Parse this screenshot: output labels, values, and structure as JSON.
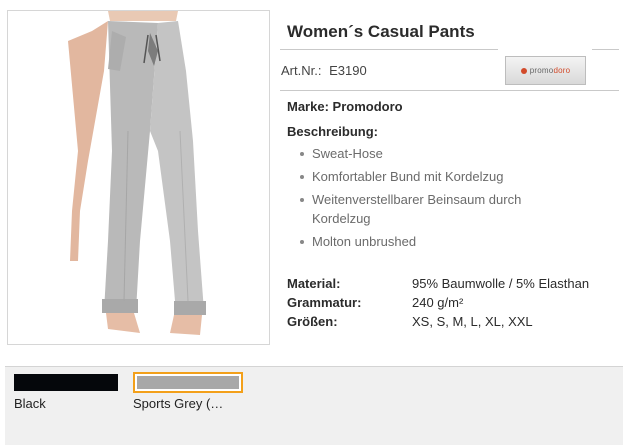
{
  "product": {
    "title": "Women´s Casual Pants",
    "art_label": "Art.Nr.:",
    "art_value": "E3190",
    "brand_logo": {
      "left": "promo",
      "right": "doro"
    }
  },
  "details": {
    "brand_line": "Marke: Promodoro",
    "description_heading": "Beschreibung:",
    "description_items": [
      "Sweat-Hose",
      "Komfortabler Bund mit Kordelzug",
      "Weitenverstellbarer Beinsaum durch Kordelzug",
      "Molton unbrushed"
    ],
    "specs": [
      {
        "key": "Material:",
        "value": "95% Baumwolle / 5% Elasthan"
      },
      {
        "key": "Grammatur:",
        "value": "240 g/m²"
      },
      {
        "key": "Größen:",
        "value": "XS, S, M, L, XL, XXL"
      }
    ]
  },
  "colors": {
    "options": [
      {
        "label": "Black",
        "hex": "#05070b"
      },
      {
        "label": "Sports Grey (…",
        "hex": "#a8a8a8",
        "selected": true
      }
    ],
    "selected_border": "#f3a01a"
  }
}
